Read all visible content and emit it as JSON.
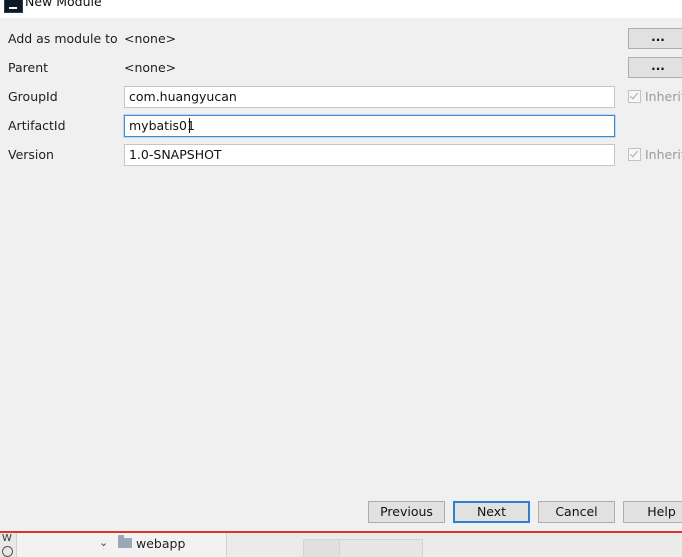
{
  "window": {
    "title": "New Module"
  },
  "form": {
    "add_as_module": {
      "label": "Add as module to",
      "value": "<none>",
      "button_label": "..."
    },
    "parent": {
      "label": "Parent",
      "value": "<none>",
      "button_label": "..."
    },
    "group_id": {
      "label": "GroupId",
      "value": "com.huangyucan",
      "inherit_label": "Inherit",
      "inherit_checked": true
    },
    "artifact_id": {
      "label": "ArtifactId",
      "value": "mybatis01"
    },
    "version": {
      "label": "Version",
      "value": "1.0-SNAPSHOT",
      "inherit_label": "Inherit",
      "inherit_checked": true
    }
  },
  "buttons": {
    "previous": "Previous",
    "next": "Next",
    "cancel": "Cancel",
    "help": "Help"
  },
  "background_ide": {
    "side_label": "W",
    "tree_item": "webapp"
  },
  "colors": {
    "focus_border": "#3c8ad6",
    "default_button_border": "#2f7fcf",
    "separator_red": "#d9352b"
  }
}
